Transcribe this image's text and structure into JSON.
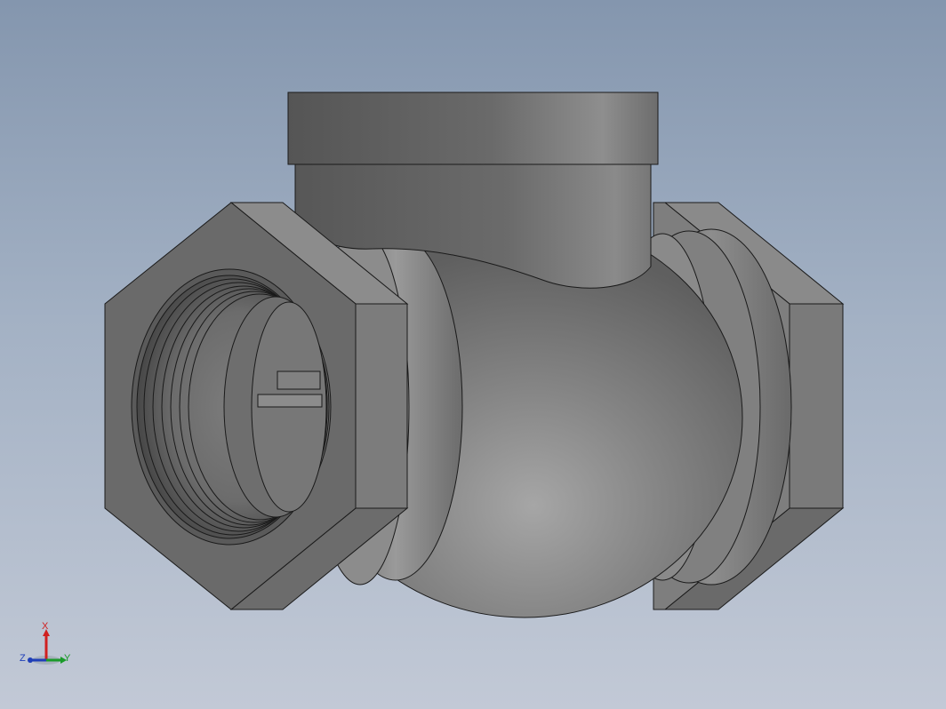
{
  "viewport": {
    "background_top": "#8496ae",
    "background_bottom": "#c2c9d6"
  },
  "model": {
    "part": "check-valve",
    "shading_color": "#6e6e6e",
    "edge_color": "#1a1a1a"
  },
  "triad": {
    "x_label": "X",
    "y_label": "Y",
    "z_label": "Z",
    "x_color": "#d02020",
    "y_color": "#1a9a2a",
    "z_color": "#1f3fb8"
  }
}
